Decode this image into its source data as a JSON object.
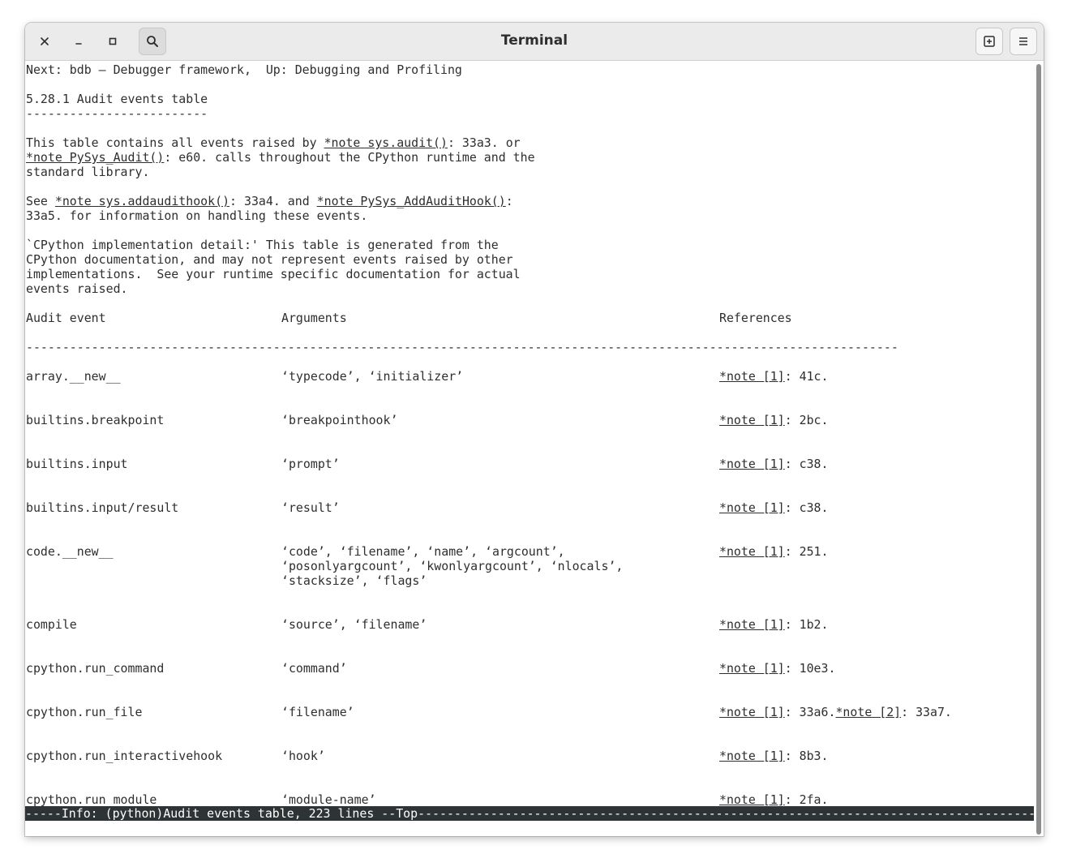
{
  "window": {
    "title": "Terminal"
  },
  "icons": {
    "close": "close-icon",
    "minimize": "minimize-icon",
    "maximize": "maximize-icon",
    "search": "search-icon",
    "new_tab": "new-tab-icon",
    "menu": "hamburger-menu-icon"
  },
  "colors": {
    "titlebar": "#ebebeb",
    "text": "#2e2e2e",
    "modeline_bg": "#2e3436",
    "modeline_fg": "#ffffff"
  },
  "doc": {
    "nav_line": "Next: bdb — Debugger framework,  Up: Debugging and Profiling",
    "heading": "5.28.1 Audit events table",
    "heading_rule": "-------------------------",
    "p1_l1_a": "This table contains all events raised by ",
    "p1_l1_link": "*note sys.audit()",
    "p1_l1_b": ": 33a3. or",
    "p1_l2_link": "*note PySys_Audit()",
    "p1_l2_b": ": e60. calls throughout the CPython runtime and the",
    "p1_l3": "standard library.",
    "p2_l1_a": "See ",
    "p2_l1_link1": "*note sys.addaudithook()",
    "p2_l1_b": ": 33a4. and ",
    "p2_l1_link2": "*note PySys_AddAuditHook()",
    "p2_l1_c": ":",
    "p2_l2": "33a5. for information on handling these events.",
    "p3_l1": "`CPython implementation detail:' This table is generated from the",
    "p3_l2": "CPython documentation, and may not represent events raised by other",
    "p3_l3": "implementations.  See your runtime specific documentation for actual",
    "p3_l4": "events raised.",
    "table_headers": {
      "event": "Audit event",
      "args": "Arguments",
      "refs": "References"
    },
    "table_rule": "------------------------------------------------------------------------------------------------------------------------",
    "rows": [
      {
        "event": "array.__new__",
        "args": [
          "‘typecode’, ‘initializer’"
        ],
        "ref_link": "*note [1]",
        "ref_text": ": 41c."
      },
      {
        "event": "builtins.breakpoint",
        "args": [
          "‘breakpointhook’"
        ],
        "ref_link": "*note [1]",
        "ref_text": ": 2bc."
      },
      {
        "event": "builtins.input",
        "args": [
          "‘prompt’"
        ],
        "ref_link": "*note [1]",
        "ref_text": ": c38."
      },
      {
        "event": "builtins.input/result",
        "args": [
          "‘result’"
        ],
        "ref_link": "*note [1]",
        "ref_text": ": c38."
      },
      {
        "event": "code.__new__",
        "args": [
          "‘code’, ‘filename’, ‘name’, ‘argcount’,",
          "‘posonlyargcount’, ‘kwonlyargcount’, ‘nlocals’,",
          "‘stacksize’, ‘flags’"
        ],
        "ref_link": "*note [1]",
        "ref_text": ": 251."
      },
      {
        "event": "compile",
        "args": [
          "‘source’, ‘filename’"
        ],
        "ref_link": "*note [1]",
        "ref_text": ": 1b2."
      },
      {
        "event": "cpython.run_command",
        "args": [
          "‘command’"
        ],
        "ref_link": "*note [1]",
        "ref_text": ": 10e3."
      },
      {
        "event": "cpython.run_file",
        "args": [
          "‘filename’"
        ],
        "ref_link": "*note [1]",
        "ref_text": ": 33a6.",
        "ref_link2": "*note [2]",
        "ref_text2": ": 33a7."
      },
      {
        "event": "cpython.run_interactivehook",
        "args": [
          "‘hook’"
        ],
        "ref_link": "*note [1]",
        "ref_text": ": 8b3."
      },
      {
        "event": "cpython.run_module",
        "args": [
          "‘module-name’"
        ],
        "ref_link": "*note [1]",
        "ref_text": ": 2fa."
      }
    ]
  },
  "modeline": {
    "text": "-----Info: (python)Audit events table, 223 lines --Top---------------------------------------------------------------------------------------------------------------------------------"
  }
}
